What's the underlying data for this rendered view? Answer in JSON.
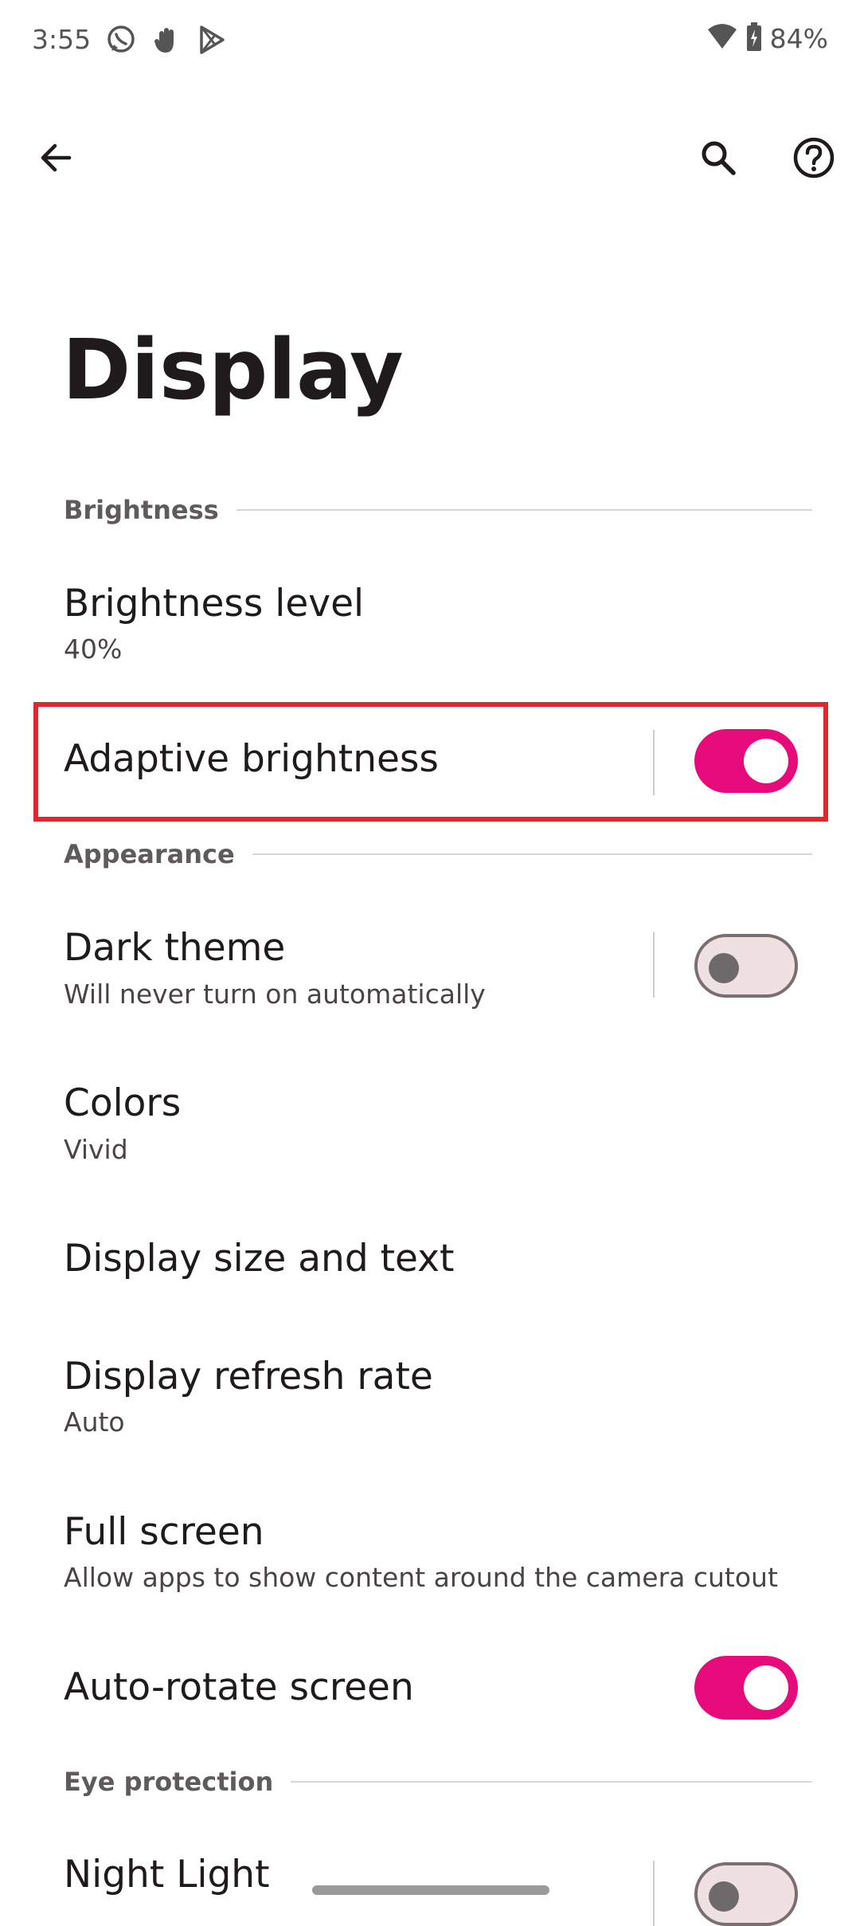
{
  "status_bar": {
    "time": "3:55",
    "battery": "84%",
    "notification_icons": [
      "whatsapp-icon",
      "hand-icon",
      "play-store-icon"
    ],
    "system_icons": [
      "wifi-icon",
      "battery-charging-icon"
    ]
  },
  "toolbar": {
    "back_icon": "arrow-back-icon",
    "search_icon": "search-icon",
    "help_icon": "help-icon"
  },
  "page": {
    "title": "Display"
  },
  "sections": {
    "brightness": "Brightness",
    "appearance": "Appearance",
    "eye_protection": "Eye protection"
  },
  "items": {
    "brightness_level": {
      "title": "Brightness level",
      "summary": "40%"
    },
    "adaptive_brightness": {
      "title": "Adaptive brightness",
      "enabled": true
    },
    "dark_theme": {
      "title": "Dark theme",
      "summary": "Will never turn on automatically",
      "enabled": false
    },
    "colors": {
      "title": "Colors",
      "summary": "Vivid"
    },
    "display_size": {
      "title": "Display size and text"
    },
    "refresh_rate": {
      "title": "Display refresh rate",
      "summary": "Auto"
    },
    "full_screen": {
      "title": "Full screen",
      "summary": "Allow apps to show content around the camera cutout"
    },
    "auto_rotate": {
      "title": "Auto-rotate screen",
      "enabled": true
    },
    "night_light": {
      "title": "Night Light",
      "enabled": false
    }
  },
  "colors": {
    "accent": "#e60a7a",
    "highlight_border": "#e0252f",
    "switch_off_track": "#efe0e2"
  }
}
